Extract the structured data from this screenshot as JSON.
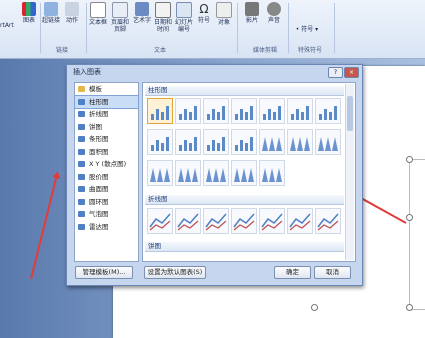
{
  "ribbon": {
    "left_partial": "rtArt",
    "chart": "图表",
    "hyperlink": "超链接",
    "action": "动作",
    "textbox": "文本框",
    "header_footer_1": "页眉和",
    "header_footer_2": "页脚",
    "wordart": "艺术字",
    "datetime_1": "日期和",
    "datetime_2": "时间",
    "slide_no_1": "幻灯片",
    "slide_no_2": "编号",
    "symbol": "符号",
    "object": "对象",
    "movie": "影片",
    "sound": "声音",
    "special_symbol": "符号",
    "group_links": "链接",
    "group_text": "文本",
    "group_media": "媒体剪辑",
    "group_special": "特殊符号"
  },
  "dialog": {
    "title": "插入图表",
    "help": "?",
    "close": "×",
    "chart_types": [
      {
        "label": "模板",
        "color": "#e5b84a"
      },
      {
        "label": "柱形图",
        "color": "#4f7fc4"
      },
      {
        "label": "折线图",
        "color": "#4f7fc4"
      },
      {
        "label": "饼图",
        "color": "#4f7fc4"
      },
      {
        "label": "条形图",
        "color": "#4f7fc4"
      },
      {
        "label": "面积图",
        "color": "#4f7fc4"
      },
      {
        "label": "X Y (散点图)",
        "color": "#4f7fc4"
      },
      {
        "label": "股价图",
        "color": "#4f7fc4"
      },
      {
        "label": "曲面图",
        "color": "#4f7fc4"
      },
      {
        "label": "圆环图",
        "color": "#4f7fc4"
      },
      {
        "label": "气泡图",
        "color": "#4f7fc4"
      },
      {
        "label": "雷达图",
        "color": "#4f7fc4"
      }
    ],
    "selected_type": "柱形图",
    "section_column": "柱形图",
    "section_line": "折线图",
    "section_pie": "饼图",
    "manage_templates": "管理模板(M)...",
    "set_default": "设置为默认图表(S)",
    "ok": "确定",
    "cancel": "取消"
  },
  "annotation_color": "#e23b3b"
}
